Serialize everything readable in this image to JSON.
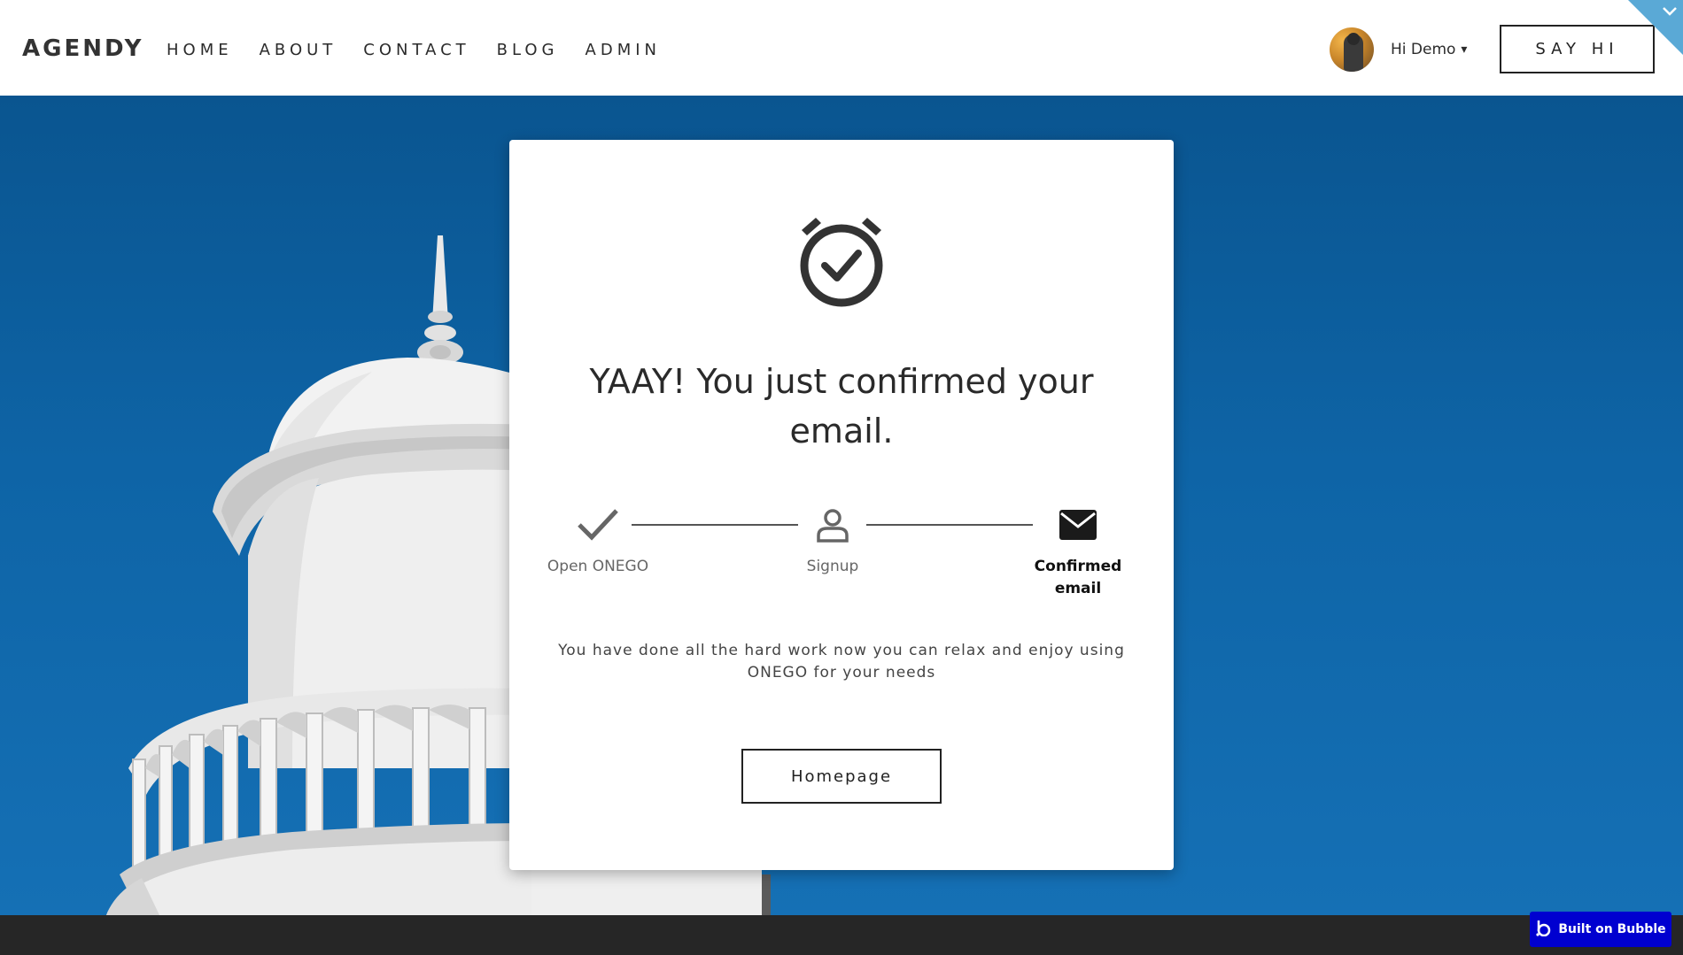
{
  "header": {
    "logo": "AGENDY",
    "nav": [
      "HOME",
      "ABOUT",
      "CONTACT",
      "BLOG",
      "ADMIN"
    ],
    "user_greeting": "Hi Demo",
    "user_caret": "▾",
    "cta_label": "SAY HI",
    "corner_chevron": "⌄"
  },
  "card": {
    "icon": "alarm-check-icon",
    "title": "YAAY! You just confirmed your email.",
    "steps": [
      {
        "label": "Open ONEGO",
        "icon": "checkmark-icon",
        "active": false
      },
      {
        "label": "Signup",
        "icon": "user-icon",
        "active": false
      },
      {
        "label": "Confirmed email",
        "icon": "envelope-icon",
        "active": true
      }
    ],
    "description": "You have done all the hard work now you can relax and enjoy using ONEGO for your needs",
    "button_label": "Homepage"
  },
  "badge": {
    "label": "Built on Bubble",
    "icon": "bubble-logo-icon"
  },
  "colors": {
    "sky": "#0e64a6",
    "badge": "#0000d0",
    "corner_tab": "#5aa9d6",
    "footer": "#262626"
  }
}
